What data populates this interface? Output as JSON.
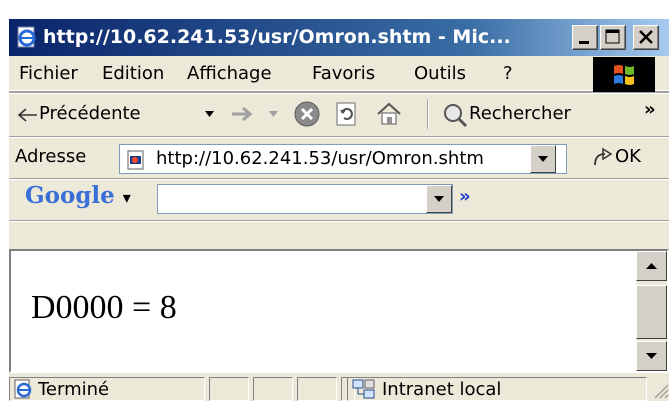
{
  "window": {
    "title": "http://10.62.241.53/usr/Omron.shtm - Mic...",
    "colors": {
      "titlebar": "#0a246a",
      "chrome": "#ece9d8",
      "link_blue": "#1a3cc8"
    }
  },
  "menu": {
    "items": [
      {
        "label": "Fichier"
      },
      {
        "label": "Edition"
      },
      {
        "label": "Affichage"
      },
      {
        "label": "Favoris"
      },
      {
        "label": "Outils"
      },
      {
        "label": "?"
      }
    ]
  },
  "toolbar": {
    "back_label": "Précédente",
    "search_label": "Rechercher",
    "overflow": "»"
  },
  "address": {
    "label": "Adresse",
    "url": "http://10.62.241.53/usr/Omron.shtm",
    "go_label": "OK"
  },
  "google": {
    "logo": "Google",
    "dropdown_arrow": "▾",
    "search_value": "",
    "overflow": "»"
  },
  "content": {
    "text": "D0000 = 8"
  },
  "status": {
    "text": "Terminé",
    "zone": "Intranet local"
  },
  "icons": [
    "ie-page-icon",
    "minimize-icon",
    "maximize-icon",
    "close-icon",
    "windows-logo-icon",
    "back-arrow-icon",
    "forward-arrow-icon",
    "stop-icon",
    "refresh-icon",
    "home-icon",
    "search-icon",
    "page-icon",
    "go-arrow-icon",
    "ie-status-icon",
    "intranet-icon"
  ]
}
